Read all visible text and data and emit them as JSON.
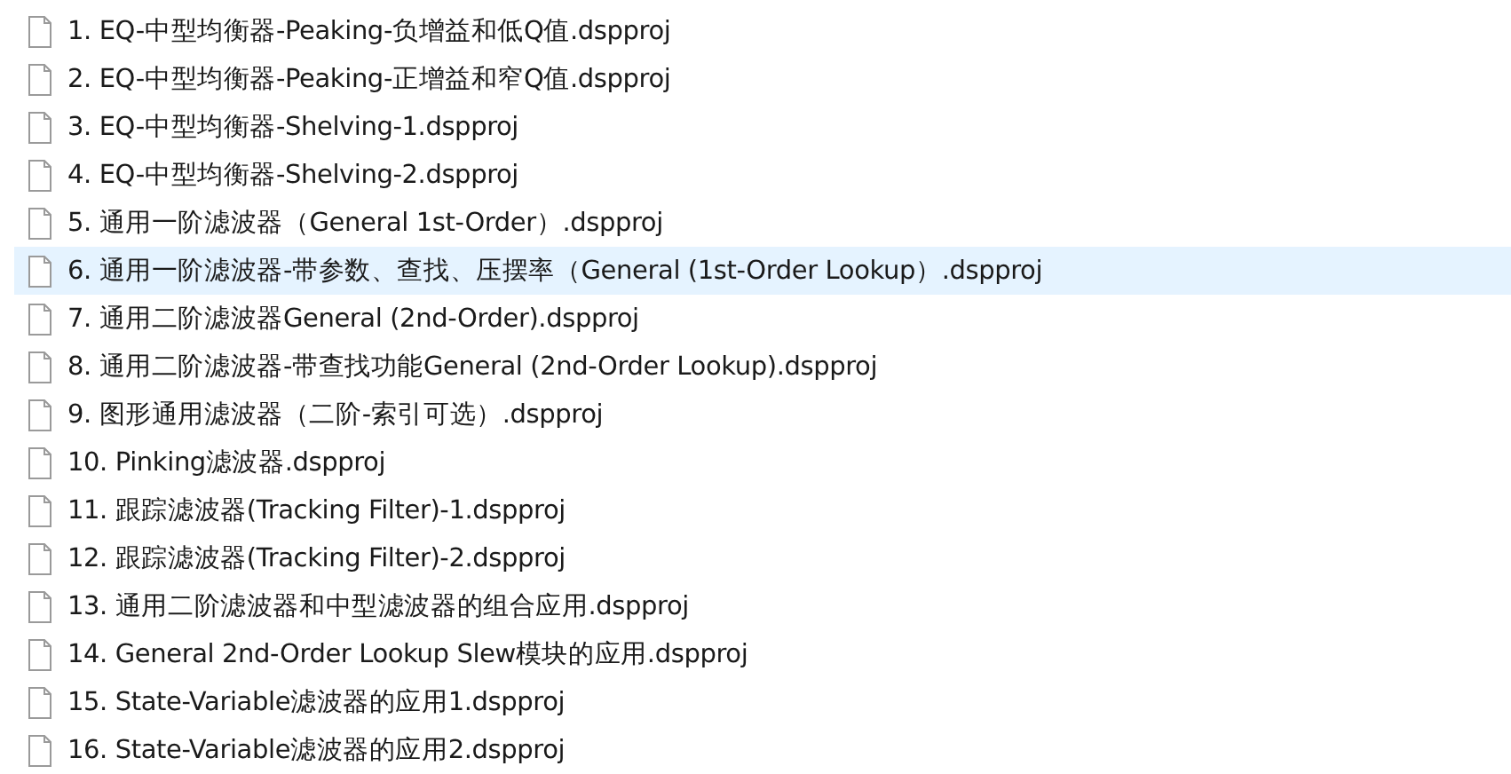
{
  "files": [
    {
      "name": "1. EQ-中型均衡器-Peaking-负增益和低Q值.dspproj",
      "selected": false
    },
    {
      "name": "2. EQ-中型均衡器-Peaking-正增益和窄Q值.dspproj",
      "selected": false
    },
    {
      "name": "3. EQ-中型均衡器-Shelving-1.dspproj",
      "selected": false
    },
    {
      "name": "4. EQ-中型均衡器-Shelving-2.dspproj",
      "selected": false
    },
    {
      "name": "5. 通用一阶滤波器（General 1st-Order）.dspproj",
      "selected": false
    },
    {
      "name": "6. 通用一阶滤波器-带参数、查找、压摆率（General (1st-Order Lookup）.dspproj",
      "selected": true
    },
    {
      "name": "7. 通用二阶滤波器General (2nd-Order).dspproj",
      "selected": false
    },
    {
      "name": "8. 通用二阶滤波器-带查找功能General (2nd-Order Lookup).dspproj",
      "selected": false
    },
    {
      "name": "9. 图形通用滤波器（二阶-索引可选）.dspproj",
      "selected": false
    },
    {
      "name": "10. Pinking滤波器.dspproj",
      "selected": false
    },
    {
      "name": "11. 跟踪滤波器(Tracking Filter)-1.dspproj",
      "selected": false
    },
    {
      "name": "12. 跟踪滤波器(Tracking Filter)-2.dspproj",
      "selected": false
    },
    {
      "name": "13. 通用二阶滤波器和中型滤波器的组合应用.dspproj",
      "selected": false
    },
    {
      "name": "14. General 2nd-Order Lookup Slew模块的应用.dspproj",
      "selected": false
    },
    {
      "name": "15. State-Variable滤波器的应用1.dspproj",
      "selected": false
    },
    {
      "name": "16. State-Variable滤波器的应用2.dspproj",
      "selected": false
    }
  ]
}
